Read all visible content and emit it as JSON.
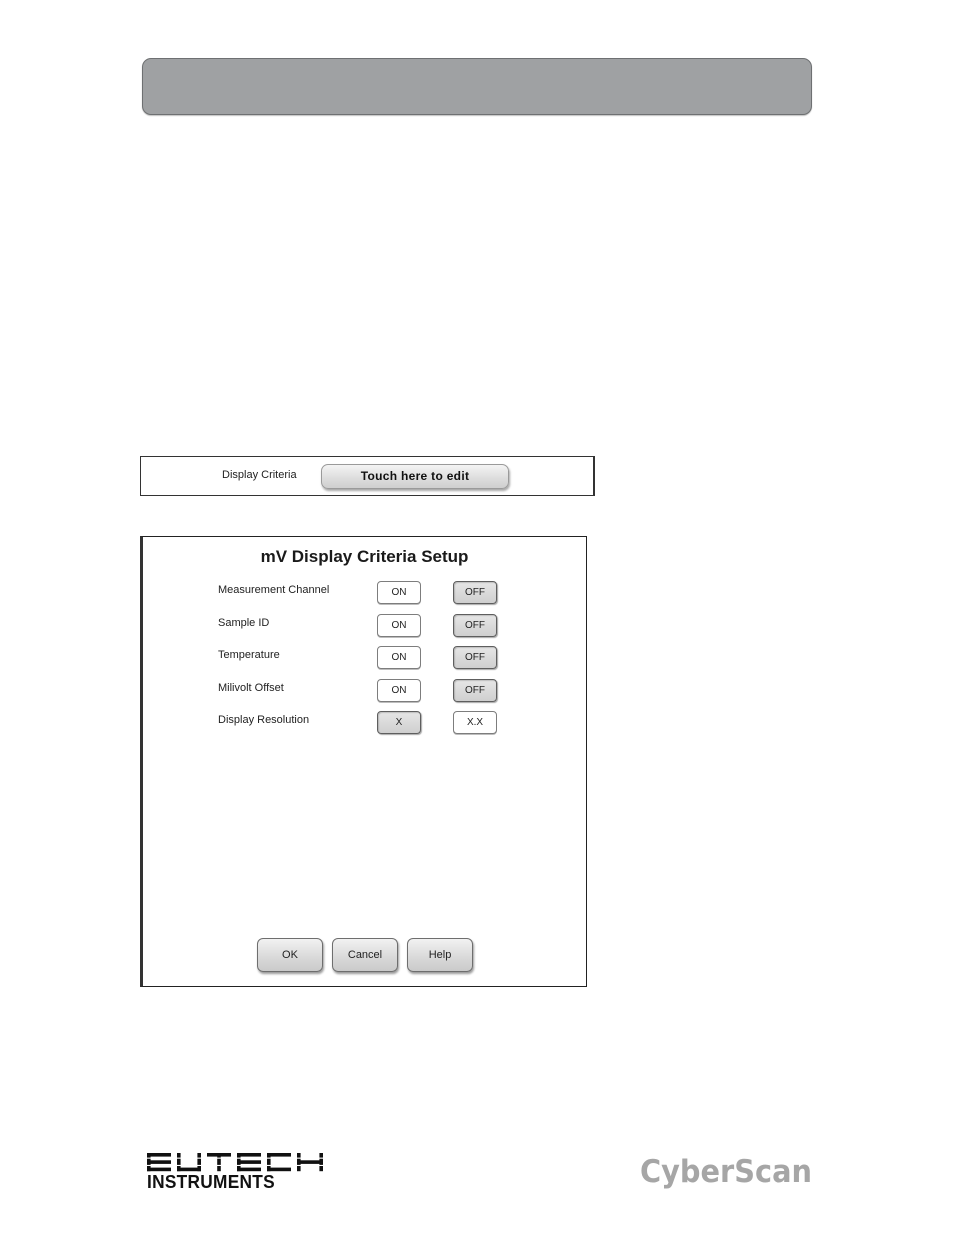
{
  "criteria_strip": {
    "label": "Display Criteria",
    "edit_button": "Touch here to edit"
  },
  "dialog": {
    "title": "mV Display Criteria Setup",
    "rows": [
      {
        "label": "Measurement Channel",
        "option_a": "ON",
        "option_b": "OFF",
        "selected": "b"
      },
      {
        "label": "Sample ID",
        "option_a": "ON",
        "option_b": "OFF",
        "selected": "b"
      },
      {
        "label": "Temperature",
        "option_a": "ON",
        "option_b": "OFF",
        "selected": "b"
      },
      {
        "label": "Milivolt Offset",
        "option_a": "ON",
        "option_b": "OFF",
        "selected": "b"
      },
      {
        "label": "Display Resolution",
        "option_a": "X",
        "option_b": "X.X",
        "selected": "a"
      }
    ],
    "buttons": {
      "ok": "OK",
      "cancel": "Cancel",
      "help": "Help"
    }
  },
  "footer": {
    "eutech_logo": "EUTECH",
    "eutech_subtitle": "INSTRUMENTS",
    "cyberscan_logo": "CyberScan"
  },
  "colors": {
    "header_bar": "#9fa1a3",
    "cyberscan_grey": "#a6a6a6"
  }
}
